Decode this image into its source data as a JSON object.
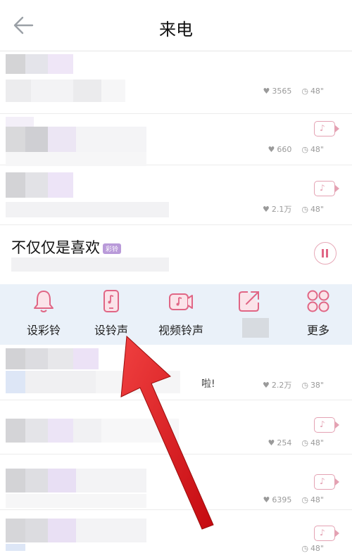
{
  "header": {
    "title": "来电",
    "back_icon": "arrow-left-icon"
  },
  "rows": [
    {
      "likes": "3565",
      "duration": "48\"",
      "has_video": false
    },
    {
      "likes": "660",
      "duration": "48\"",
      "has_video": true
    },
    {
      "likes": "2.1万",
      "duration": "48\"",
      "has_video": true
    }
  ],
  "now_playing": {
    "title": "不仅仅是喜欢",
    "tag": "彩铃"
  },
  "actions": [
    {
      "label": "设彩铃",
      "icon": "bell-icon"
    },
    {
      "label": "设铃声",
      "icon": "phone-music-icon"
    },
    {
      "label": "视频铃声",
      "icon": "video-music-icon"
    },
    {
      "label": "",
      "icon": "share-icon"
    },
    {
      "label": "更多",
      "icon": "more-grid-icon"
    }
  ],
  "rows_below": [
    {
      "snippet": "啦!",
      "likes": "2.2万",
      "duration": "38\""
    },
    {
      "likes": "254",
      "duration": "48\""
    },
    {
      "likes": "6395",
      "duration": "48\""
    },
    {
      "likes": "",
      "duration": "48\""
    }
  ],
  "colors": {
    "accent": "#e06685",
    "actions_bg": "#eaf1f9",
    "arrow": "#e8141b"
  }
}
